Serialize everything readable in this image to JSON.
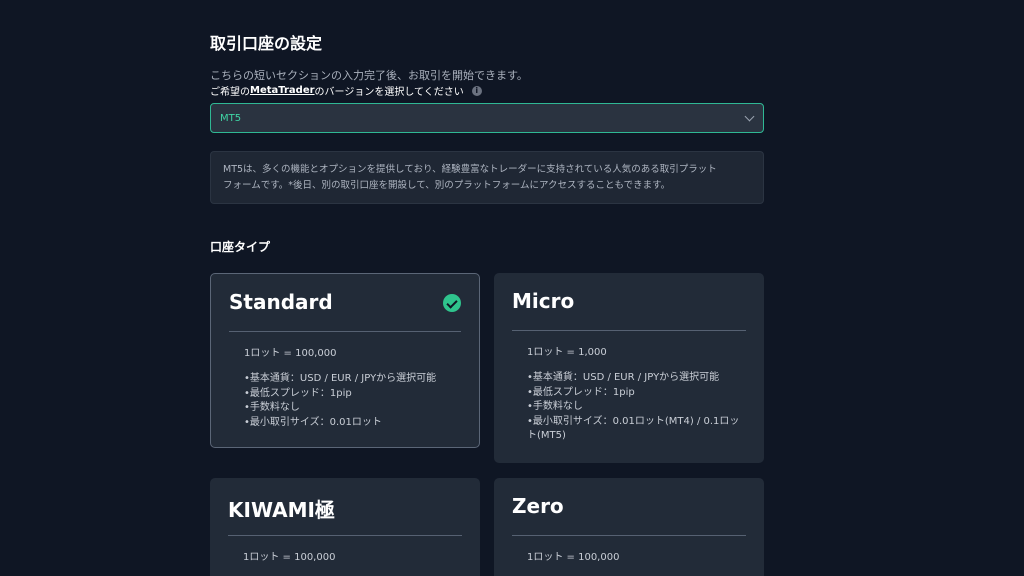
{
  "header": {
    "title": "取引口座の設定",
    "subtitle": "こちらの短いセクションの入力完了後、お取引を開始できます。",
    "platform_label_pre": "ご希望の",
    "platform_label_link": "MetaTrader",
    "platform_label_post": "のバージョンを選択してください"
  },
  "platform_select": {
    "value": "MT5"
  },
  "description": {
    "line1": "MT5は、多くの機能とオプションを提供しており、経験豊富なトレーダーに支持されている人気のある取引プラット",
    "line2": "フォームです。*後日、別の取引口座を開設して、別のプラットフォームにアクセスすることもできます。"
  },
  "account_types": {
    "title": "口座タイプ",
    "cards": [
      {
        "name": "Standard",
        "selected": true,
        "lot": "1ロット = 100,000",
        "features": [
          "•基本通貨：USD / EUR / JPYから選択可能",
          "•最低スプレッド：1pip",
          "•手数料なし",
          "•最小取引サイズ：0.01ロット"
        ]
      },
      {
        "name": "Micro",
        "selected": false,
        "lot": "1ロット = 1,000",
        "features": [
          "•基本通貨：USD / EUR / JPYから選択可能",
          "•最低スプレッド：1pip",
          "•手数料なし",
          "•最小取引サイズ：0.01ロット(MT4) / 0.1ロット(MT5)"
        ]
      },
      {
        "name": "KIWAMI極",
        "selected": false,
        "lot": "1ロット = 100,000",
        "features": []
      },
      {
        "name": "Zero",
        "selected": false,
        "lot": "1ロット = 100,000",
        "features": []
      }
    ]
  },
  "colors": {
    "background": "#0f1624",
    "card": "#222b38",
    "accent": "#2fc48d",
    "select_border": "#2fb894"
  }
}
